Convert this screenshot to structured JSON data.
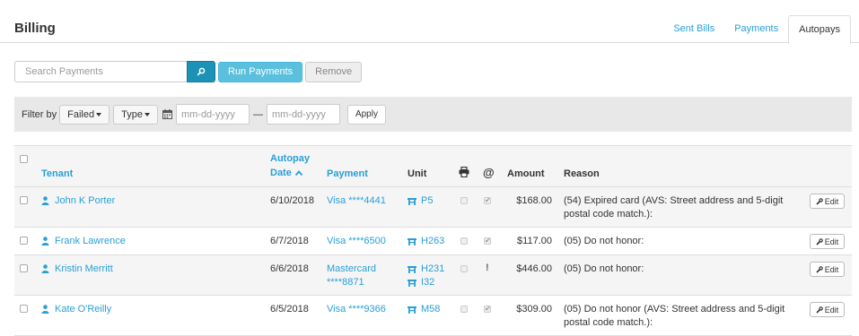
{
  "header": {
    "title": "Billing",
    "tabs": [
      {
        "label": "Sent Bills",
        "active": false
      },
      {
        "label": "Payments",
        "active": false
      },
      {
        "label": "Autopays",
        "active": true
      }
    ]
  },
  "toolbar": {
    "search_placeholder": "Search Payments",
    "search_icon": "search-icon",
    "run_label": "Run Payments",
    "remove_label": "Remove"
  },
  "filter": {
    "label": "Filter by",
    "status_value": "Failed",
    "type_value": "Type",
    "from_placeholder": "mm-dd-yyyy",
    "separator": "—",
    "to_placeholder": "mm-dd-yyyy",
    "apply_label": "Apply"
  },
  "table": {
    "headers": {
      "tenant": "Tenant",
      "autopay_line1": "Autopay",
      "autopay_line2": "Date",
      "payment": "Payment",
      "unit": "Unit",
      "print_icon": "printer-icon",
      "email_icon": "@",
      "amount": "Amount",
      "reason": "Reason"
    },
    "edit_label": "Edit",
    "rows": [
      {
        "tenant": "John K Porter",
        "date": "6/10/2018",
        "payment": [
          "Visa ****4441"
        ],
        "units": [
          "P5"
        ],
        "email_status": "check",
        "amount": "$168.00",
        "reason": [
          "(54) Expired card (AVS: Street address and 5-digit",
          "postal code match.):"
        ]
      },
      {
        "tenant": "Frank Lawrence",
        "date": "6/7/2018",
        "payment": [
          "Visa ****6500"
        ],
        "units": [
          "H263"
        ],
        "email_status": "check",
        "amount": "$117.00",
        "reason": [
          "(05) Do not honor:"
        ]
      },
      {
        "tenant": "Kristin Merritt",
        "date": "6/6/2018",
        "payment": [
          "Mastercard",
          "****8871"
        ],
        "units": [
          "H231",
          "I32"
        ],
        "email_status": "!",
        "amount": "$446.00",
        "reason": [
          "(05) Do not honor:"
        ]
      },
      {
        "tenant": "Kate O'Reilly",
        "date": "6/5/2018",
        "payment": [
          "Visa ****9366"
        ],
        "units": [
          "M58"
        ],
        "email_status": "check",
        "amount": "$309.00",
        "reason": [
          "(05) Do not honor (AVS: Street address and 5-digit",
          "postal code match.):"
        ]
      }
    ]
  }
}
